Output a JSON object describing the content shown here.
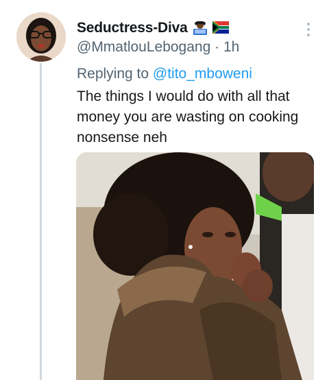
{
  "tweet": {
    "display_name": "Seductress-Diva",
    "name_emojis": [
      "technologist-emoji",
      "south-africa-flag-emoji"
    ],
    "handle": "@MmatlouLebogang",
    "separator": "·",
    "time": "1h",
    "replying_prefix": "Replying to",
    "replying_to": "@tito_mboweni",
    "text": "The things I would do with all that money you are wasting on cooking nonsense neh",
    "media": {
      "description_icon": "photo"
    }
  },
  "colors": {
    "text": "#14171a",
    "secondary": "#536471",
    "link": "#1d9bf0",
    "thread_line": "#cfd9de"
  }
}
